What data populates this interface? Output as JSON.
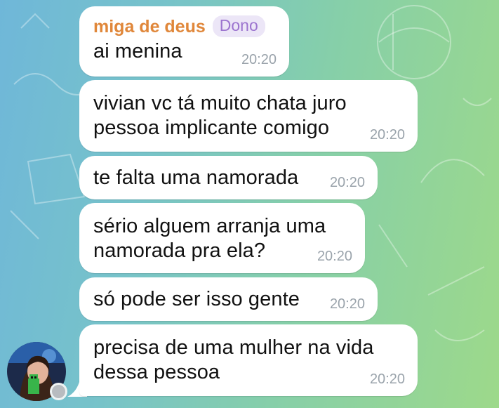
{
  "chat": {
    "sender_name": "miga de deus",
    "sender_badge": "Dono",
    "messages": [
      {
        "text": "ai menina",
        "time": "20:20"
      },
      {
        "text": "vivian vc tá muito chata juro\npessoa implicante comigo",
        "time": "20:20"
      },
      {
        "text": "te falta uma namorada",
        "time": "20:20"
      },
      {
        "text": "sério alguem arranja uma\nnamorada pra ela?",
        "time": "20:20"
      },
      {
        "text": "só pode ser isso gente",
        "time": "20:20"
      },
      {
        "text": "precisa de uma mulher na vida\ndessa pessoa",
        "time": "20:20"
      }
    ]
  },
  "colors": {
    "sender_name": "#e0873a",
    "badge_text": "#9c74cf",
    "badge_bg": "#ece6f7",
    "timestamp": "#9aa3ab",
    "bubble": "#ffffff"
  },
  "icons": {
    "online_status": "status-dot-icon"
  }
}
